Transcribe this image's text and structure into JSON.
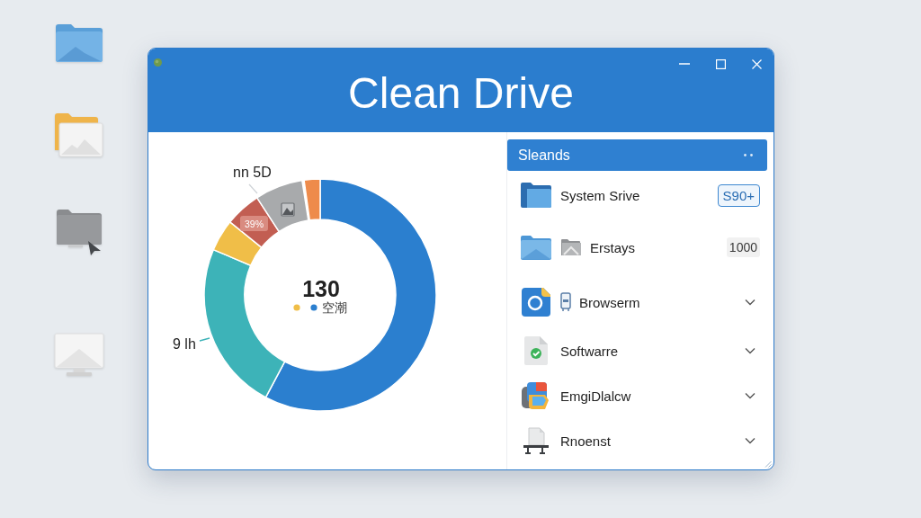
{
  "window": {
    "title": "Clean Drive"
  },
  "chart": {
    "top_label": "nn 5D",
    "slice_label": "39%",
    "left_label": "9 lh",
    "center_value": "130",
    "legend": {
      "dots": [
        {
          "color": "#f0be48"
        },
        {
          "color": "#2b7fcf"
        }
      ],
      "label": "空潮"
    }
  },
  "panel": {
    "title": "Sleands"
  },
  "items": [
    {
      "label": "System Srive",
      "trailing": {
        "kind": "badge",
        "text": "S90+"
      }
    },
    {
      "label": "Erstays",
      "trailing": {
        "kind": "count",
        "text": "1000"
      }
    },
    {
      "label": "Browserm",
      "trailing": {
        "kind": "chevron"
      }
    },
    {
      "label": "Softwarre",
      "trailing": {
        "kind": "chevron"
      }
    },
    {
      "label": "EmgiDlalcw",
      "trailing": {
        "kind": "chevron"
      }
    },
    {
      "label": "Rnoenst",
      "trailing": {
        "kind": "chevron"
      }
    }
  ]
}
